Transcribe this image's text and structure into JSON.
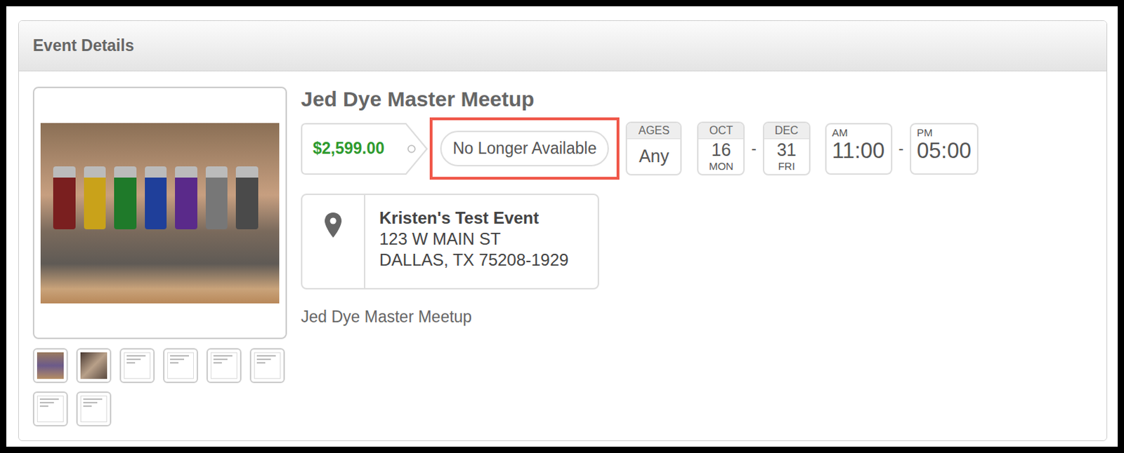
{
  "header": {
    "title": "Event Details"
  },
  "gallery": {
    "thumbnails": [
      {
        "kind": "photo"
      },
      {
        "kind": "photo"
      },
      {
        "kind": "screenshot"
      },
      {
        "kind": "screenshot"
      },
      {
        "kind": "screenshot"
      },
      {
        "kind": "screenshot"
      },
      {
        "kind": "screenshot"
      },
      {
        "kind": "screenshot"
      }
    ]
  },
  "event": {
    "title": "Jed Dye Master Meetup",
    "price": "$2,599.00",
    "status": {
      "text": "No Longer Available",
      "highlighted": true
    },
    "ages": {
      "label": "AGES",
      "value": "Any"
    },
    "start_date": {
      "month": "OCT",
      "day": "16",
      "weekday": "MON"
    },
    "date_separator": "-",
    "end_date": {
      "month": "DEC",
      "day": "31",
      "weekday": "FRI"
    },
    "start_time": {
      "period": "AM",
      "time": "11:00"
    },
    "time_separator": "-",
    "end_time": {
      "period": "PM",
      "time": "05:00"
    },
    "location": {
      "name": "Kristen's Test Event",
      "street": "123 W MAIN ST",
      "city": "DALLAS, TX 75208-1929"
    },
    "description": "Jed Dye Master Meetup"
  }
}
